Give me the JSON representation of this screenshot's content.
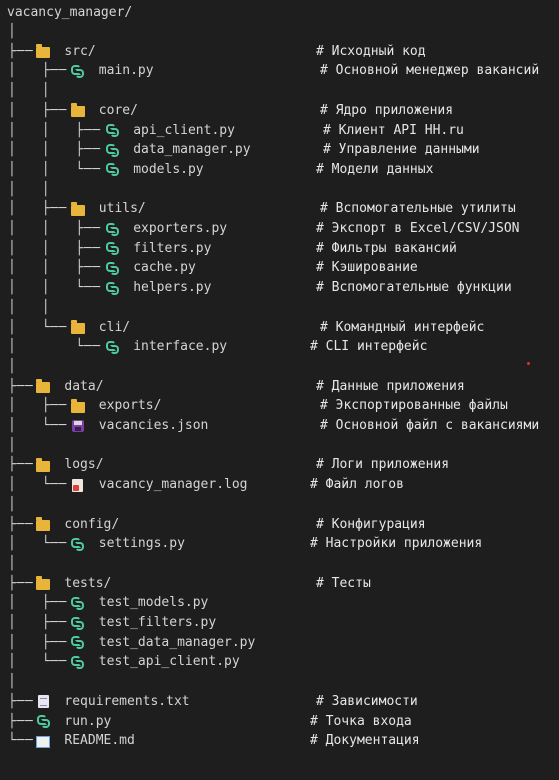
{
  "root": "vacancy_manager/",
  "rows": [
    {
      "guide": "│",
      "icon": "",
      "name": "",
      "comment": ""
    },
    {
      "guide": "├── ",
      "icon": "folder-icon",
      "name": "src/",
      "comment": "# Исходный код"
    },
    {
      "guide": "│   ├── ",
      "icon": "python-icon",
      "name": "main.py",
      "comment": "# Основной менеджер вакансий"
    },
    {
      "guide": "│   │",
      "icon": "",
      "name": "",
      "comment": ""
    },
    {
      "guide": "│   ├── ",
      "icon": "folder-icon",
      "name": "core/",
      "comment": "# Ядро приложения"
    },
    {
      "guide": "│   │   ├── ",
      "icon": "python-icon",
      "name": "api_client.py",
      "comment": "# Клиент API HH.ru"
    },
    {
      "guide": "│   │   ├── ",
      "icon": "python-icon",
      "name": "data_manager.py",
      "comment": "# Управление данными"
    },
    {
      "guide": "│   │   └── ",
      "icon": "python-icon",
      "name": "models.py",
      "comment": "# Модели данных"
    },
    {
      "guide": "│   │",
      "icon": "",
      "name": "",
      "comment": ""
    },
    {
      "guide": "│   ├── ",
      "icon": "folder-icon",
      "name": "utils/",
      "comment": "# Вспомогательные утилиты"
    },
    {
      "guide": "│   │   ├── ",
      "icon": "python-icon",
      "name": "exporters.py",
      "comment": "# Экспорт в Excel/CSV/JSON"
    },
    {
      "guide": "│   │   ├── ",
      "icon": "python-icon",
      "name": "filters.py",
      "comment": "# Фильтры вакансий"
    },
    {
      "guide": "│   │   ├── ",
      "icon": "python-icon",
      "name": "cache.py",
      "comment": "# Кэширование"
    },
    {
      "guide": "│   │   └── ",
      "icon": "python-icon",
      "name": "helpers.py",
      "comment": "# Вспомогательные функции"
    },
    {
      "guide": "│   │",
      "icon": "",
      "name": "",
      "comment": ""
    },
    {
      "guide": "│   └── ",
      "icon": "folder-icon",
      "name": "cli/",
      "comment": "# Командный интерфейс"
    },
    {
      "guide": "│       └── ",
      "icon": "python-icon",
      "name": "interface.py",
      "comment": "# CLI интерфейс"
    },
    {
      "guide": "│",
      "icon": "",
      "name": "",
      "comment": ""
    },
    {
      "guide": "├── ",
      "icon": "folder-icon",
      "name": "data/",
      "comment": "# Данные приложения"
    },
    {
      "guide": "│   ├── ",
      "icon": "folder-icon",
      "name": "exports/",
      "comment": "# Экспортированные файлы"
    },
    {
      "guide": "│   └── ",
      "icon": "floppy-icon",
      "name": "vacancies.json",
      "comment": "# Основной файл с вакансиями"
    },
    {
      "guide": "│",
      "icon": "",
      "name": "",
      "comment": ""
    },
    {
      "guide": "├── ",
      "icon": "folder-icon",
      "name": "logs/",
      "comment": "# Логи приложения"
    },
    {
      "guide": "│   └── ",
      "icon": "log-file-icon",
      "name": "vacancy_manager.log",
      "comment": "# Файл логов"
    },
    {
      "guide": "│",
      "icon": "",
      "name": "",
      "comment": ""
    },
    {
      "guide": "├── ",
      "icon": "folder-icon",
      "name": "config/",
      "comment": "# Конфигурация"
    },
    {
      "guide": "│   └── ",
      "icon": "python-icon",
      "name": "settings.py",
      "comment": "# Настройки приложения"
    },
    {
      "guide": "│",
      "icon": "",
      "name": "",
      "comment": ""
    },
    {
      "guide": "├── ",
      "icon": "folder-icon",
      "name": "tests/",
      "comment": "# Тесты"
    },
    {
      "guide": "│   ├── ",
      "icon": "python-icon",
      "name": "test_models.py",
      "comment": ""
    },
    {
      "guide": "│   ├── ",
      "icon": "python-icon",
      "name": "test_filters.py",
      "comment": ""
    },
    {
      "guide": "│   ├── ",
      "icon": "python-icon",
      "name": "test_data_manager.py",
      "comment": ""
    },
    {
      "guide": "│   └── ",
      "icon": "python-icon",
      "name": "test_api_client.py",
      "comment": ""
    },
    {
      "guide": "│",
      "icon": "",
      "name": "",
      "comment": ""
    },
    {
      "guide": "├── ",
      "icon": "text-file-icon",
      "name": "requirements.txt",
      "comment": "# Зависимости"
    },
    {
      "guide": "├── ",
      "icon": "python-icon",
      "name": "run.py",
      "comment": "# Точка входа"
    },
    {
      "guide": "└── ",
      "icon": "book-icon",
      "name": "README.md",
      "comment": "# Документация"
    }
  ],
  "colors": {
    "background": "#1e1e1e",
    "text": "#d4d4d4",
    "folder": "#e8b53a",
    "python": "#4ec9a0"
  }
}
